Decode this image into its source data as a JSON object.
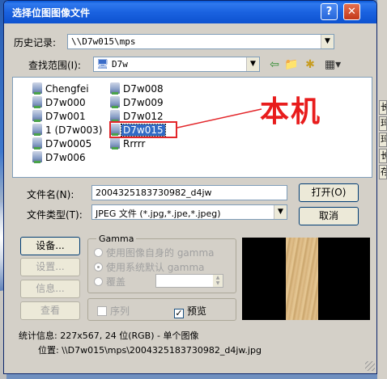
{
  "window": {
    "title": "选择位图图像文件",
    "help_label": "?",
    "close_label": "✕"
  },
  "history": {
    "label": "历史记录:",
    "value": "\\\\D7w015\\mps"
  },
  "lookin": {
    "label": "查找范围(I):",
    "value": "D7w"
  },
  "files": [
    {
      "name": "Chengfei"
    },
    {
      "name": "D7w000"
    },
    {
      "name": "D7w001"
    },
    {
      "name": "1 (D7w003)"
    },
    {
      "name": "D7w0005"
    },
    {
      "name": "D7w006"
    },
    {
      "name": "D7w008"
    },
    {
      "name": "D7w009"
    },
    {
      "name": "D7w012"
    },
    {
      "name": "D7w015",
      "selected": true
    },
    {
      "name": "Rrrrr"
    }
  ],
  "annotation": {
    "text": "本机",
    "color": "#e81c1c"
  },
  "filename": {
    "label": "文件名(N):",
    "value": "2004325183730982_d4jw"
  },
  "filetype": {
    "label": "文件类型(T):",
    "value": "JPEG 文件 (*.jpg,*.jpe,*.jpeg)"
  },
  "buttons": {
    "open": "打开(O)",
    "cancel": "取消",
    "setup1": "设备...",
    "setup2": "设置...",
    "info": "信息...",
    "view": "查看"
  },
  "gamma": {
    "legend": "Gamma",
    "opt1": "使用图像自身的 gamma",
    "opt2": "使用系统默认 gamma",
    "opt3": "覆盖"
  },
  "options": {
    "sequence": "序列",
    "preview": "预览"
  },
  "status": {
    "stats": "统计信息: 227x567, 24 位(RGB) - 单个图像",
    "location": "位置: \\\\D7w015\\mps\\2004325183730982_d4jw.jpg"
  },
  "right_tabs": [
    "长",
    "玛",
    "玛",
    "长",
    "存"
  ]
}
